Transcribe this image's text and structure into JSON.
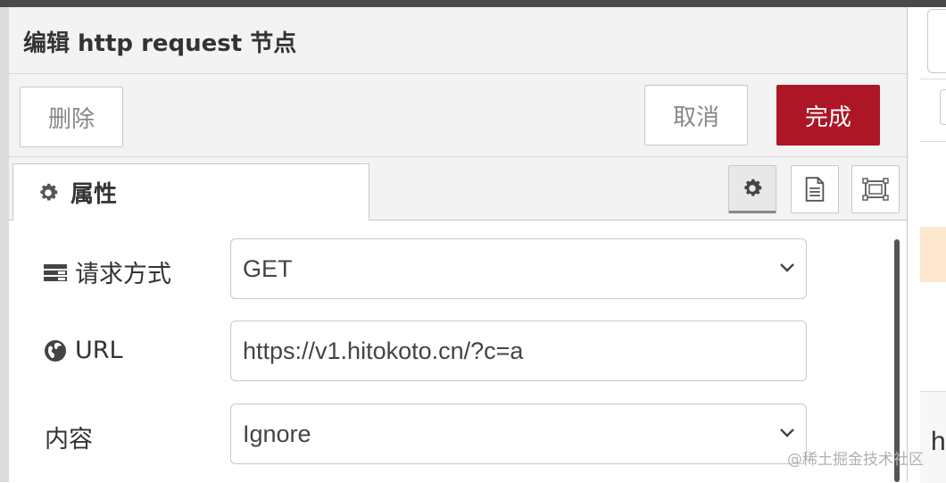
{
  "tray": {
    "title": "编辑 http request 节点"
  },
  "toolbar": {
    "delete_label": "删除",
    "cancel_label": "取消",
    "done_label": "完成"
  },
  "tabs": [
    {
      "label": "属性",
      "icon": "gear-icon"
    }
  ],
  "tab_tools": [
    {
      "name": "node-settings",
      "icon": "gear-icon",
      "active": true
    },
    {
      "name": "node-description",
      "icon": "document-icon"
    },
    {
      "name": "node-appearance",
      "icon": "frame-icon"
    }
  ],
  "form": {
    "method": {
      "label": "请求方式",
      "icon": "list-icon",
      "value": "GET"
    },
    "url": {
      "label": "URL",
      "icon": "globe-icon",
      "value": "https://v1.hitokoto.cn/?c=a"
    },
    "payload": {
      "label": "内容",
      "value": "Ignore"
    }
  },
  "right_panel": {
    "partial_text": "h"
  },
  "watermark": "@稀土掘金技术社区",
  "colors": {
    "done_button": "#ad1625",
    "panel_bg": "#f3f3f3",
    "highlight": "#fde8cf"
  }
}
